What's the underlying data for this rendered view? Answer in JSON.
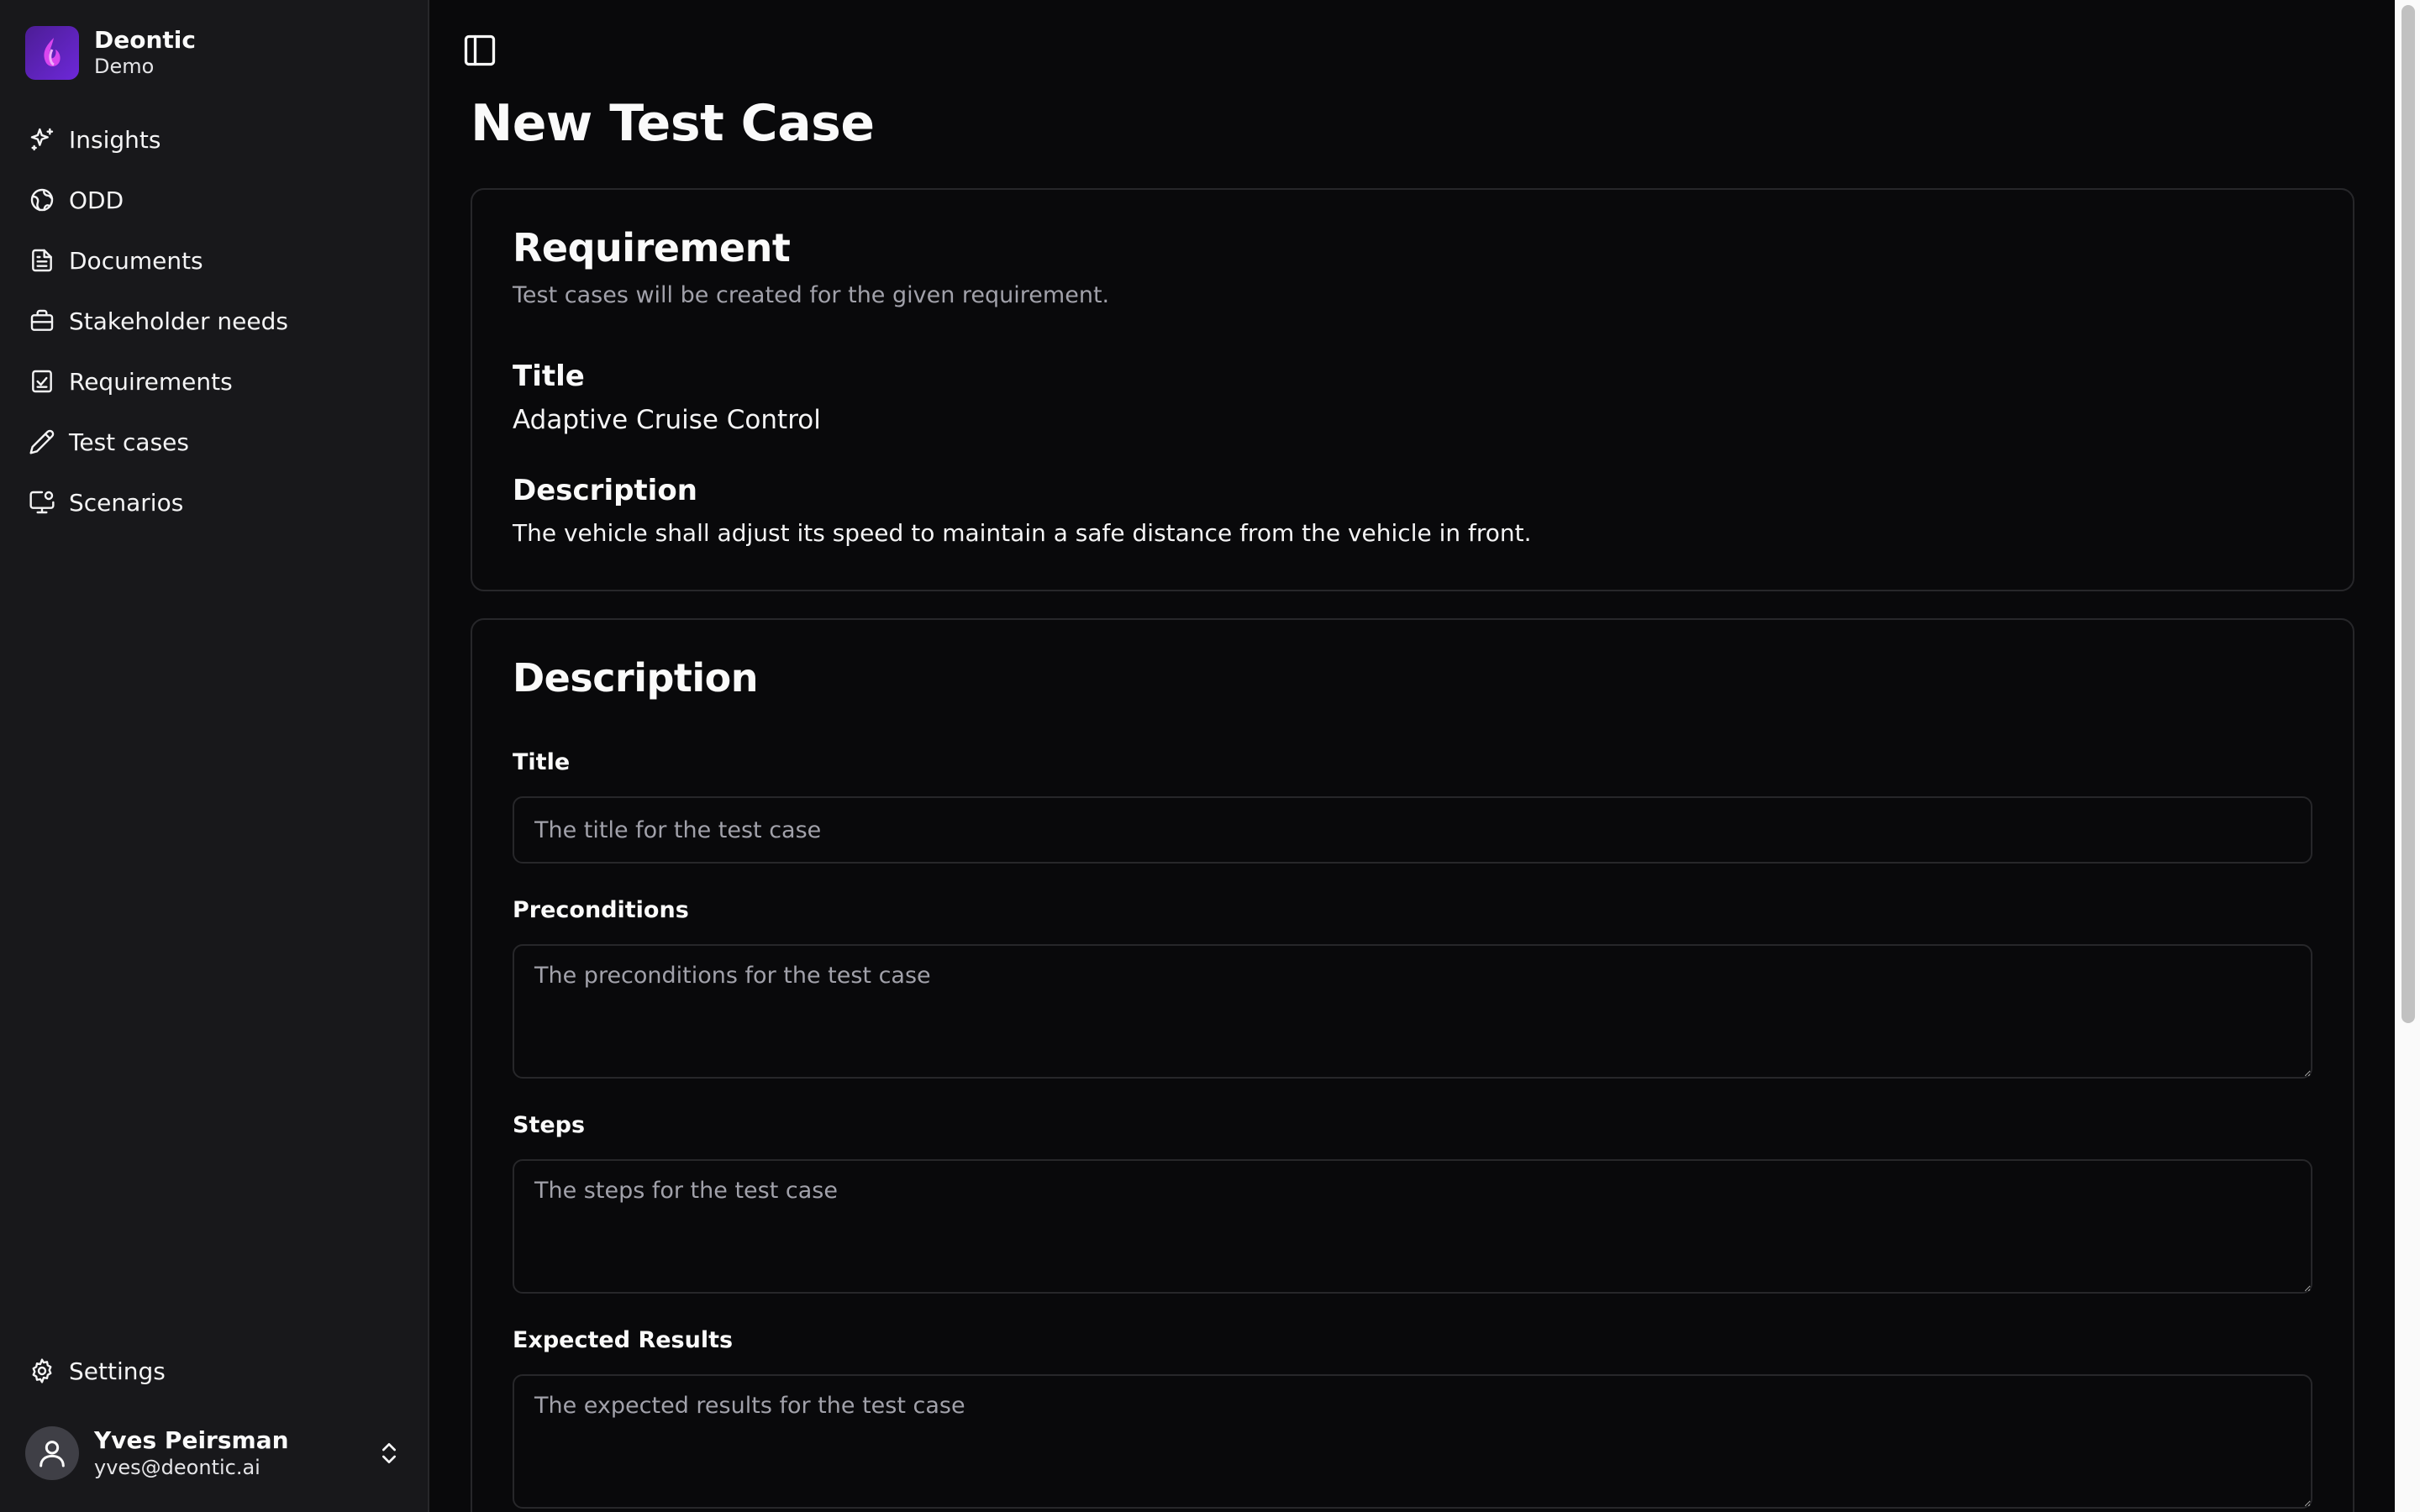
{
  "brand": {
    "name": "Deontic",
    "subtitle": "Demo"
  },
  "nav": {
    "items": [
      {
        "label": "Insights",
        "icon": "sparkles-icon"
      },
      {
        "label": "ODD",
        "icon": "globe-icon"
      },
      {
        "label": "Documents",
        "icon": "file-text-icon"
      },
      {
        "label": "Stakeholder needs",
        "icon": "briefcase-icon"
      },
      {
        "label": "Requirements",
        "icon": "clipboard-check-icon"
      },
      {
        "label": "Test cases",
        "icon": "pencil-icon"
      },
      {
        "label": "Scenarios",
        "icon": "monitor-icon"
      }
    ],
    "settings": "Settings"
  },
  "user": {
    "name": "Yves Peirsman",
    "email": "yves@deontic.ai"
  },
  "page": {
    "title": "New Test Case"
  },
  "requirement": {
    "heading": "Requirement",
    "subtitle": "Test cases will be created for the given requirement.",
    "title_label": "Title",
    "title_value": "Adaptive Cruise Control",
    "description_label": "Description",
    "description_value": "The vehicle shall adjust its speed to maintain a safe distance from the vehicle in front."
  },
  "form": {
    "heading": "Description",
    "title_label": "Title",
    "title_placeholder": "The title for the test case",
    "preconditions_label": "Preconditions",
    "preconditions_placeholder": "The preconditions for the test case",
    "steps_label": "Steps",
    "steps_placeholder": "The steps for the test case",
    "expected_label": "Expected Results",
    "expected_placeholder": "The expected results for the test case"
  }
}
